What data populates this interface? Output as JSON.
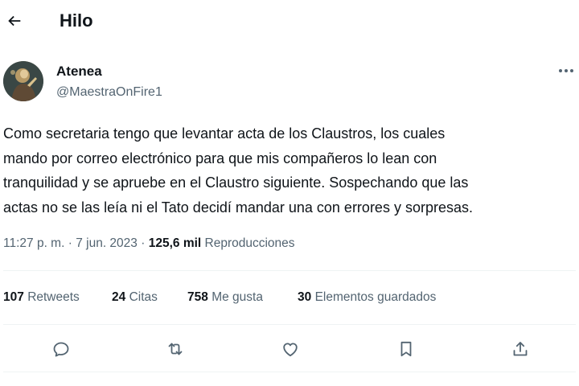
{
  "header": {
    "title": "Hilo",
    "back_icon": "arrow-left-icon"
  },
  "author": {
    "name": "Atenea",
    "handle": "@MaestraOnFire1",
    "more_icon": "more-horizontal-icon"
  },
  "tweet": {
    "lines": [
      "Como secretaria tengo que levantar acta de los Claustros, los cuales",
      "mando por correo electrónico para que mis compañeros lo lean con",
      "tranquilidad y se apruebe en el Claustro siguiente. Sospechando que las",
      "actas no se las leía ni el Tato decidí mandar una con errores y sorpresas."
    ]
  },
  "meta": {
    "time": "11:27 p. m.",
    "separator": "·",
    "date": "7 jun. 2023",
    "views_count": "125,6 mil",
    "views_label": "Reproducciones"
  },
  "stats": {
    "retweets": {
      "count": "107",
      "label": "Retweets"
    },
    "quotes": {
      "count": "24",
      "label": "Citas"
    },
    "likes": {
      "count": "758",
      "label": "Me gusta"
    },
    "bookmarks": {
      "count": "30",
      "label": "Elementos guardados"
    }
  },
  "actions": [
    "reply-icon",
    "retweet-icon",
    "like-icon",
    "bookmark-icon",
    "share-icon"
  ],
  "colors": {
    "text": "#0f1419",
    "secondary": "#536471",
    "divider": "#eff3f4",
    "background": "#ffffff"
  }
}
